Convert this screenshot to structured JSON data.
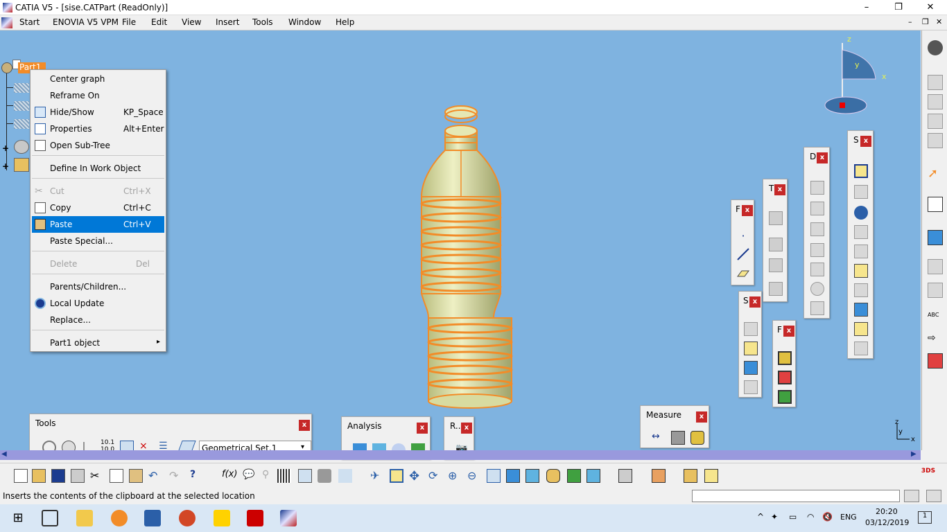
{
  "window": {
    "title": "CATIA V5 - [sise.CATPart (ReadOnly)]",
    "minimize": "–",
    "maximize": "❐",
    "close": "✕"
  },
  "menubar": {
    "items": [
      "Start",
      "ENOVIA V5 VPM",
      "File",
      "Edit",
      "View",
      "Insert",
      "Tools",
      "Window",
      "Help"
    ]
  },
  "tree": {
    "root": "Part1"
  },
  "context_menu": {
    "items": [
      {
        "label": "Center graph",
        "shortcut": ""
      },
      {
        "label": "Reframe On",
        "shortcut": ""
      },
      {
        "label": "Hide/Show",
        "shortcut": "KP_Space"
      },
      {
        "label": "Properties",
        "shortcut": "Alt+Enter"
      },
      {
        "label": "Open Sub-Tree",
        "shortcut": ""
      },
      {
        "label": "Define In Work Object",
        "shortcut": ""
      },
      {
        "label": "Cut",
        "shortcut": "Ctrl+X"
      },
      {
        "label": "Copy",
        "shortcut": "Ctrl+C"
      },
      {
        "label": "Paste",
        "shortcut": "Ctrl+V"
      },
      {
        "label": "Paste Special...",
        "shortcut": ""
      },
      {
        "label": "Delete",
        "shortcut": "Del"
      },
      {
        "label": "Parents/Children...",
        "shortcut": ""
      },
      {
        "label": "Local Update",
        "shortcut": ""
      },
      {
        "label": "Replace...",
        "shortcut": ""
      },
      {
        "label": "Part1 object",
        "shortcut": "▸"
      }
    ]
  },
  "toolbars": {
    "tools": {
      "title": "Tools",
      "select_value": "Geometrical Set.1"
    },
    "analysis": {
      "title": "Analysis"
    },
    "r": {
      "title": "R.."
    },
    "measure": {
      "title": "Measure"
    },
    "f1": {
      "title": "F"
    },
    "t": {
      "title": "T"
    },
    "d": {
      "title": "D"
    },
    "s1": {
      "title": "S"
    },
    "s2": {
      "title": "S"
    },
    "f2": {
      "title": "F"
    },
    "close": "x"
  },
  "compass": {
    "z": "z",
    "x": "x",
    "y": "y"
  },
  "axis": {
    "x": "x",
    "y": "y",
    "z": "z"
  },
  "status": {
    "message": "Inserts the contents of the clipboard at the selected location"
  },
  "taskbar": {
    "lang": "ENG",
    "time": "20:20",
    "date": "03/12/2019",
    "notifications": "1"
  },
  "colors": {
    "viewport": "#7fb3e0",
    "bottle_edges": "#f28c28",
    "bottle_fill": "#e5e8b4",
    "selection": "#0078d7",
    "tree_root_highlight": "#f28c28"
  }
}
